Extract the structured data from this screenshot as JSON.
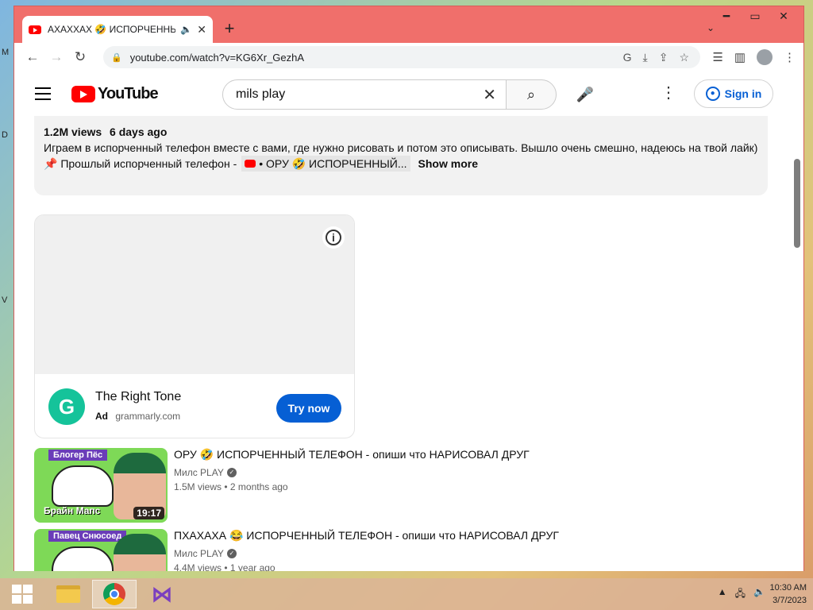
{
  "desktop": {
    "edge_letters": [
      "M",
      "D",
      "V"
    ]
  },
  "browser": {
    "tab": {
      "title": "АХАХХАХ 🤣 ИСПОРЧЕННЫЙ",
      "audio_icon": "speaker-icon",
      "close": "✕"
    },
    "new_tab": "+",
    "window_controls": {
      "minimize": "━",
      "maximize": "▭",
      "close": "✕"
    },
    "url": "youtube.com/watch?v=KG6Xr_GezhA"
  },
  "youtube": {
    "logo_text": "YouTube",
    "search_value": "mils play",
    "sign_in": "Sign in",
    "description": {
      "views": "1.2M views",
      "age": "6 days ago",
      "text": "Играем в испорченный телефон вместе с вами, где нужно рисовать и потом это описывать. Вышло очень смешно, надеюсь на твой лайк)",
      "prev_label": "📌 Прошлый испорченный телефон -",
      "prev_chip": "• ОРУ 🤣 ИСПОРЧЕННЫЙ...",
      "show_more": "Show more"
    },
    "ad": {
      "logo_letter": "G",
      "title": "The Right Tone",
      "ad_label": "Ad",
      "domain": "grammarly.com",
      "cta": "Try now"
    },
    "recommendations": [
      {
        "thumb_banner": "Блогер Пёс",
        "thumb_caption": "Брайн Мапс",
        "duration": "19:17",
        "title": "ОРУ 🤣 ИСПОРЧЕННЫЙ ТЕЛЕФОН - опиши что НАРИСОВАЛ ДРУГ",
        "channel": "Милс PLAY",
        "stats": "1.5M views  • 2 months ago"
      },
      {
        "thumb_banner": "Павец Снюсоед",
        "thumb_caption": "",
        "duration": "",
        "title": "ПХАХАХА 😂 ИСПОРЧЕННЫЙ ТЕЛЕФОН - опиши что НАРИСОВАЛ ДРУГ",
        "channel": "Милс PLAY",
        "stats": "4.4M views  • 1 year ago"
      }
    ]
  },
  "taskbar": {
    "time": "10:30 AM",
    "date": "3/7/2023"
  }
}
